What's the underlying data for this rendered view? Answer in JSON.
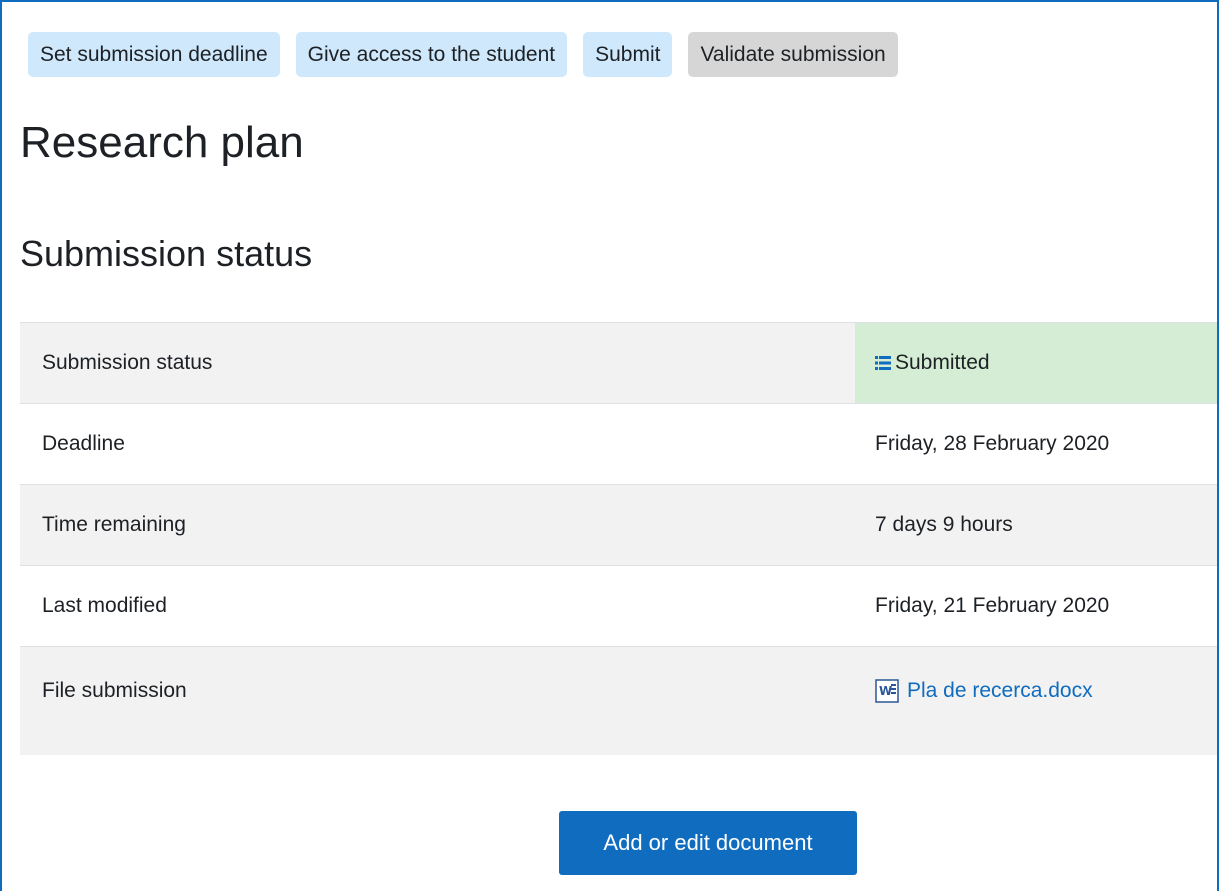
{
  "actions": {
    "set_deadline": "Set submission deadline",
    "give_access": "Give access to the student",
    "submit": "Submit",
    "validate": "Validate submission"
  },
  "page_title": "Research plan",
  "section_title": "Submission status",
  "rows": [
    {
      "label": "Submission status",
      "value": "Submitted"
    },
    {
      "label": "Deadline",
      "value": "Friday, 28 February 2020"
    },
    {
      "label": "Time remaining",
      "value": "7 days 9 hours"
    },
    {
      "label": "Last modified",
      "value": "Friday, 21 February 2020"
    },
    {
      "label": "File submission",
      "value": "Pla de recerca.docx"
    }
  ],
  "primary_button": "Add or edit document",
  "colors": {
    "accent": "#0f6cbf",
    "pill": "#cfe8fb",
    "pill_disabled": "#d6d6d6",
    "submitted_bg": "#d4edd4",
    "row_alt": "#f2f2f2"
  },
  "icons": {
    "submitted": "list-icon",
    "file": "word-document-icon"
  }
}
